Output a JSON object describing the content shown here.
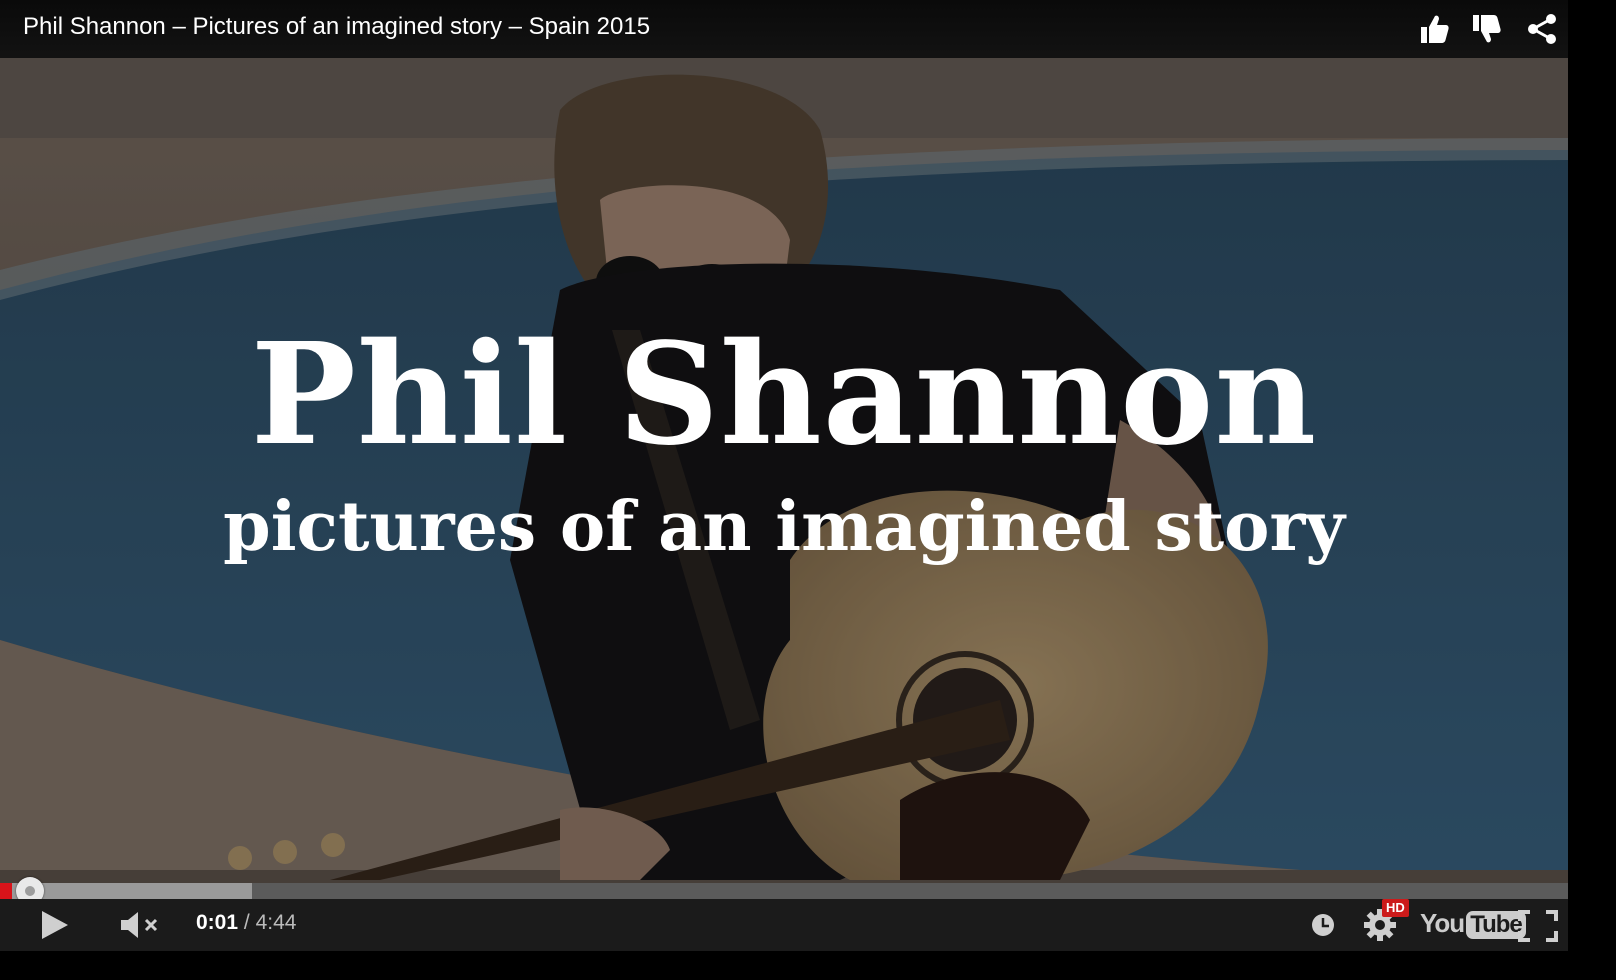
{
  "video": {
    "title": "Phil Shannon – Pictures of an imagined story – Spain 2015",
    "card_title": "Phil Shannon",
    "card_subtitle": "pictures of an imagined story"
  },
  "top_actions": [
    {
      "name": "like",
      "icon": "thumbs-up-icon"
    },
    {
      "name": "dislike",
      "icon": "thumbs-down-icon"
    },
    {
      "name": "share",
      "icon": "share-icon"
    }
  ],
  "playback": {
    "current_time": "0:01",
    "separator": "/",
    "duration": "4:44",
    "played_fraction": 0.004,
    "buffered_fraction": 0.161
  },
  "controls": {
    "play_icon": "play-icon",
    "mute_icon": "volume-muted-icon",
    "watch_later_icon": "clock-icon",
    "settings_icon": "gear-icon",
    "hd_badge": "HD",
    "logo_you": "You",
    "logo_tube": "Tube",
    "fullscreen_icon": "fullscreen-icon"
  },
  "colors": {
    "progress_played": "#d9131a",
    "hd_badge": "#cc1a1a",
    "control_bar": "#1b1b1b"
  }
}
